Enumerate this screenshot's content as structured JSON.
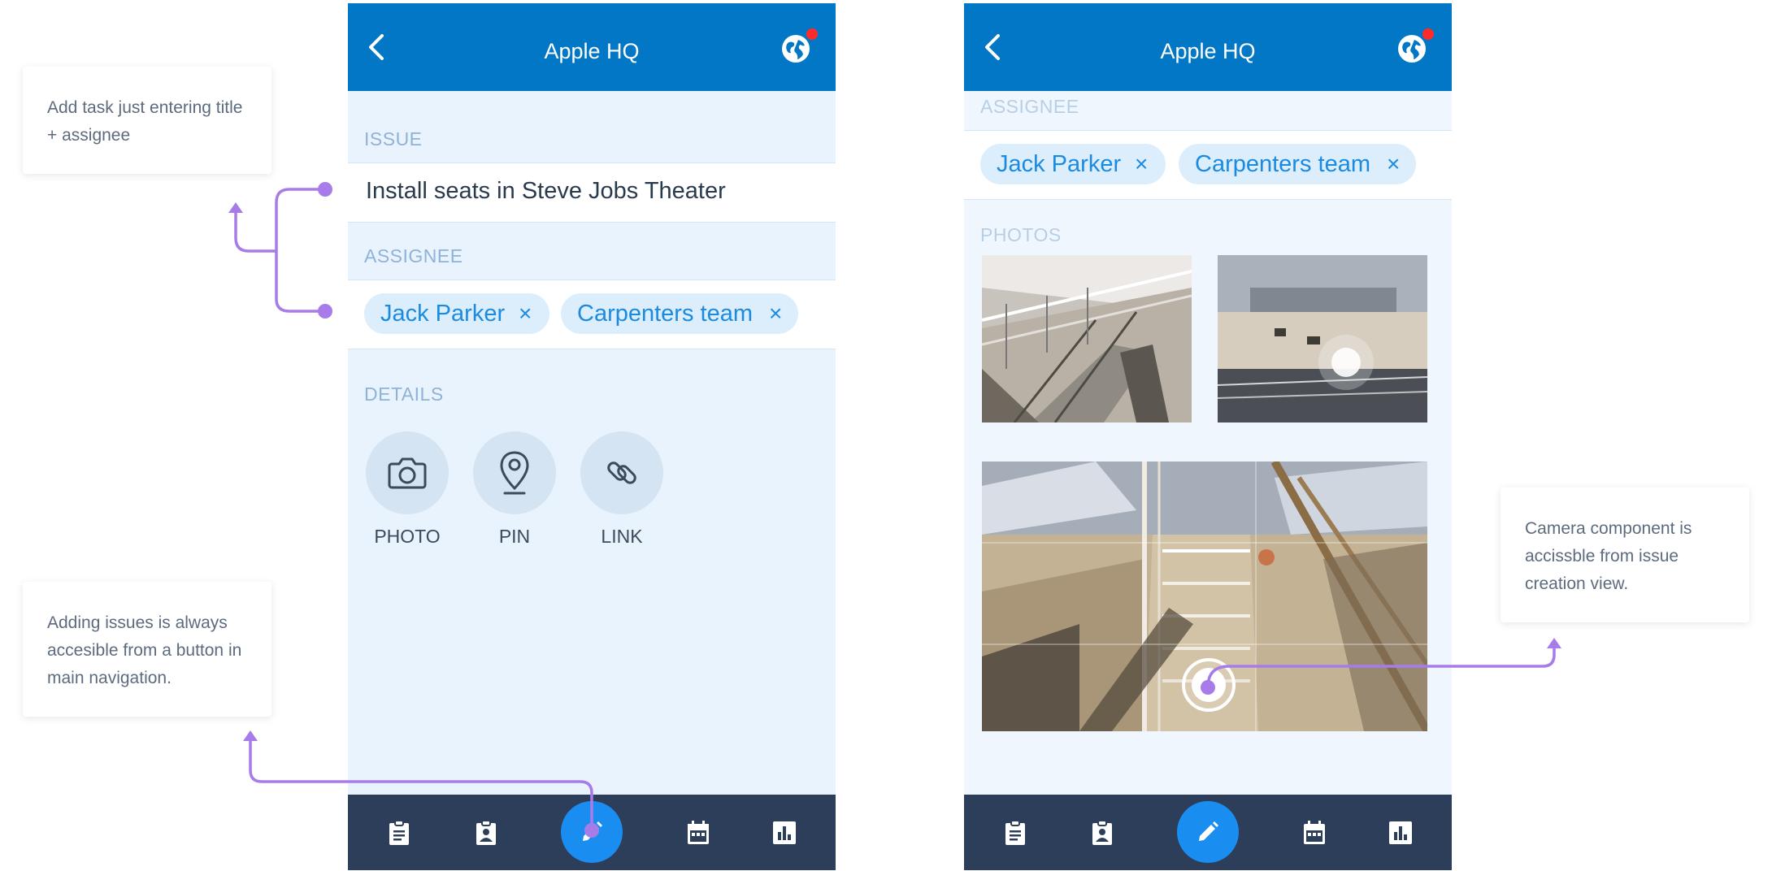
{
  "screens": {
    "left": {
      "title": "Apple HQ",
      "issue_label": "ISSUE",
      "issue_text": "Install seats in Steve Jobs Theater",
      "assignee_label": "ASSIGNEE",
      "chips": [
        "Jack Parker",
        "Carpenters team"
      ],
      "chip_remove": "×",
      "details_label": "DETAILS",
      "detail_buttons": [
        "PHOTO",
        "PIN",
        "LINK"
      ]
    },
    "right": {
      "title": "Apple HQ",
      "assignee_label": "ASSIGNEE",
      "chips": [
        "Jack Parker",
        "Carpenters team"
      ],
      "chip_remove": "×",
      "photos_label": "PHOTOS"
    }
  },
  "bottom_nav": {
    "items": [
      "clipboard-icon",
      "badge-icon",
      "pencil-icon",
      "calendar-icon",
      "bar-chart-icon"
    ]
  },
  "annotations": {
    "note_1": "Add task just entering title + assignee",
    "note_2": "Adding issues is always accesible from a button in main navigation.",
    "note_3": "Camera component is accissble from issue creation view."
  },
  "colors": {
    "header": "#0277c6",
    "nav": "#2c3e5a",
    "fab": "#1a8ef0",
    "chip_bg": "#dcedfb",
    "chip_text": "#1a8be0",
    "connector": "#a77ce9",
    "badge": "#ff2a2a"
  }
}
